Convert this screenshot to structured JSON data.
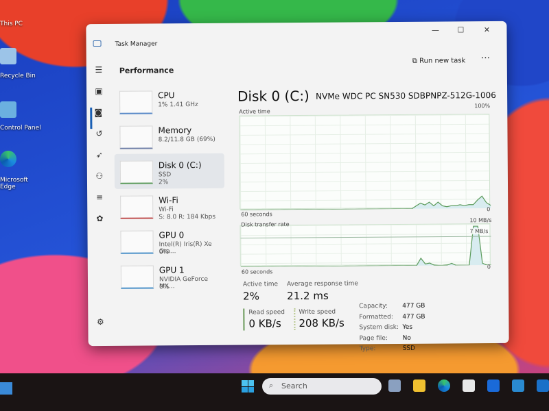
{
  "desktop": {
    "icons": [
      {
        "label": "This PC"
      },
      {
        "label": "Recycle Bin"
      },
      {
        "label": "Control Panel"
      },
      {
        "label": "Microsoft Edge"
      }
    ]
  },
  "window": {
    "title": "Task Manager",
    "controls": {
      "minimize": "—",
      "maximize": "☐",
      "close": "✕"
    }
  },
  "header": {
    "title": "Performance",
    "run_new_task": "Run new task",
    "more": "···"
  },
  "nav": [
    "menu-icon",
    "processes-icon",
    "performance-icon",
    "app-history-icon",
    "startup-icon",
    "users-icon",
    "details-icon",
    "services-icon",
    "settings-icon"
  ],
  "devices": [
    {
      "name": "CPU",
      "sub1": "1% 1.41 GHz",
      "sub2": ""
    },
    {
      "name": "Memory",
      "sub1": "8.2/11.8 GB (69%)",
      "sub2": ""
    },
    {
      "name": "Disk 0 (C:)",
      "sub1": "SSD",
      "sub2": "2%"
    },
    {
      "name": "Wi-Fi",
      "sub1": "Wi-Fi",
      "sub2": "S: 8.0 R: 184 Kbps"
    },
    {
      "name": "GPU 0",
      "sub1": "Intel(R) Iris(R) Xe Gra...",
      "sub2": "0%"
    },
    {
      "name": "GPU 1",
      "sub1": "NVIDIA GeForce MX...",
      "sub2": "0%"
    }
  ],
  "disk": {
    "title": "Disk 0 (C:)",
    "model": "NVMe WDC PC SN530 SDBPNPZ-512G-1006",
    "active_label": "Active time",
    "active_max": "100%",
    "active_min": "0",
    "active_time_span": "60 seconds",
    "transfer_label": "Disk transfer rate",
    "transfer_max": "10 MB/s",
    "transfer_mid": "7 MB/s",
    "transfer_min": "0",
    "transfer_time_span": "60 seconds",
    "stats": {
      "active_time_label": "Active time",
      "active_time": "2%",
      "avg_resp_label": "Average response time",
      "avg_resp": "21.2 ms",
      "read_label": "Read speed",
      "read": "0 KB/s",
      "write_label": "Write speed",
      "write": "208 KB/s"
    },
    "props": [
      {
        "k": "Capacity:",
        "v": "477 GB"
      },
      {
        "k": "Formatted:",
        "v": "477 GB"
      },
      {
        "k": "System disk:",
        "v": "Yes"
      },
      {
        "k": "Page file:",
        "v": "No"
      },
      {
        "k": "Type:",
        "v": "SSD"
      }
    ]
  },
  "chart_data": [
    {
      "type": "area",
      "title": "Active time",
      "ylim": [
        0,
        100
      ],
      "xlabel": "60 seconds",
      "values": [
        0,
        0,
        0,
        0,
        0,
        0,
        0,
        0,
        0,
        0,
        0,
        0,
        0,
        0,
        0,
        0,
        0,
        0,
        0,
        0,
        0,
        0,
        0,
        0,
        0,
        0,
        0,
        0,
        0,
        0,
        0,
        0,
        0,
        0,
        0,
        0,
        0,
        0,
        0,
        0,
        3,
        6,
        4,
        7,
        3,
        7,
        3,
        2,
        3,
        3,
        4,
        3,
        4,
        4,
        9,
        13,
        6,
        3
      ]
    },
    {
      "type": "area",
      "title": "Disk transfer rate",
      "ylim": [
        0,
        10
      ],
      "unit": "MB/s",
      "reference_line": 7,
      "xlabel": "60 seconds",
      "values": [
        0,
        0,
        0,
        0,
        0,
        0,
        0,
        0,
        0,
        0,
        0,
        0,
        0,
        0,
        0,
        0,
        0,
        0,
        0,
        0,
        0,
        0,
        0,
        0,
        0,
        0,
        0,
        0,
        0,
        0,
        0,
        0,
        0,
        0,
        0,
        0,
        0,
        0,
        0,
        0,
        0,
        1.8,
        0.4,
        0.6,
        0.1,
        0,
        0,
        0.1,
        0.5,
        0,
        0,
        0,
        0,
        9.5,
        9.5,
        0.5,
        0,
        0
      ]
    }
  ],
  "taskbar": {
    "search_placeholder": "Search",
    "apps": [
      "task-view",
      "file-explorer",
      "edge",
      "store",
      "dropbox",
      "app",
      "outlook"
    ]
  },
  "colors": {
    "accent": "#1a5fb4",
    "disk_line": "#5a9a5a"
  }
}
